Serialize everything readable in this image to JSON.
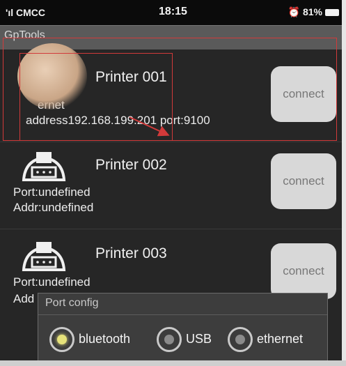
{
  "status_bar": {
    "carrier": "'ıl CMCC",
    "time": "18:15",
    "battery": "81%"
  },
  "app": {
    "title": "GpTools"
  },
  "printers": [
    {
      "name": "Printer 001",
      "line1": "ernet",
      "line2": "address192.168.199.201 port:9100",
      "button": "connect"
    },
    {
      "name": "Printer 002",
      "line1": "Port:undefined",
      "line2": "Addr:undefined",
      "button": "connect"
    },
    {
      "name": "Printer 003",
      "line1": "Port:undefined",
      "line2": "Add",
      "button": "connect"
    }
  ],
  "popup": {
    "title": "Port config",
    "options": [
      {
        "label": "bluetooth",
        "selected": true
      },
      {
        "label": "USB",
        "selected": false
      },
      {
        "label": "ethernet",
        "selected": false
      }
    ]
  },
  "colors": {
    "annotation": "#d23a3a",
    "selected_radio": "#e6e27a"
  }
}
